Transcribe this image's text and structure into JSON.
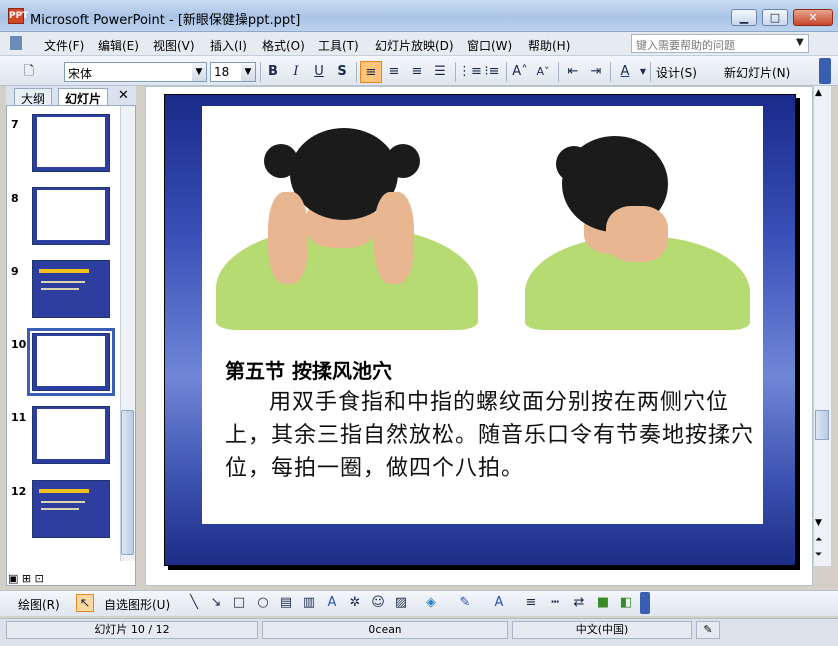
{
  "window": {
    "app_icon": "PPT",
    "title": "Microsoft PowerPoint - [新眼保健操ppt.ppt]",
    "min_label": "▁",
    "max_label": "□",
    "close_label": "✕"
  },
  "menubar": {
    "items": [
      "文件(F)",
      "编辑(E)",
      "视图(V)",
      "插入(I)",
      "格式(O)",
      "工具(T)",
      "幻灯片放映(D)",
      "窗口(W)",
      "帮助(H)"
    ],
    "help_placeholder": "键入需要帮助的问题"
  },
  "toolbar": {
    "font_name": "宋体",
    "font_size": "18",
    "bold": "B",
    "italic": "I",
    "underline": "U",
    "shadow": "S",
    "increase_font": "A˄",
    "decrease_font": "A˅",
    "font_color": "A",
    "design_label": "设计(S)",
    "new_slide_label": "新幻灯片(N)"
  },
  "leftpane": {
    "tab_outline": "大纲",
    "tab_slides": "幻灯片",
    "close": "✕",
    "thumbnails": [
      {
        "num": "7",
        "kind": "photo"
      },
      {
        "num": "8",
        "kind": "photo"
      },
      {
        "num": "9",
        "kind": "text"
      },
      {
        "num": "10",
        "kind": "photo",
        "selected": true
      },
      {
        "num": "11",
        "kind": "photo"
      },
      {
        "num": "12",
        "kind": "text"
      }
    ]
  },
  "slide": {
    "heading": "第五节  按揉风池穴",
    "body": "用双手食指和中指的螺纹面分别按在两侧穴位上，其余三指自然放松。随音乐口令有节奏地按揉穴位，每拍一圈，做四个八拍。"
  },
  "drawbar": {
    "draw_label": "绘图(R)",
    "autoshapes_label": "自选图形(U)"
  },
  "statusbar": {
    "slide_position": "幻灯片 10 / 12",
    "design_name": "Ocean",
    "language": "中文(中国)"
  },
  "colors": {
    "slide_background": "#3850b8",
    "shirt": "#b6db72",
    "hair": "#1b1b1b"
  }
}
